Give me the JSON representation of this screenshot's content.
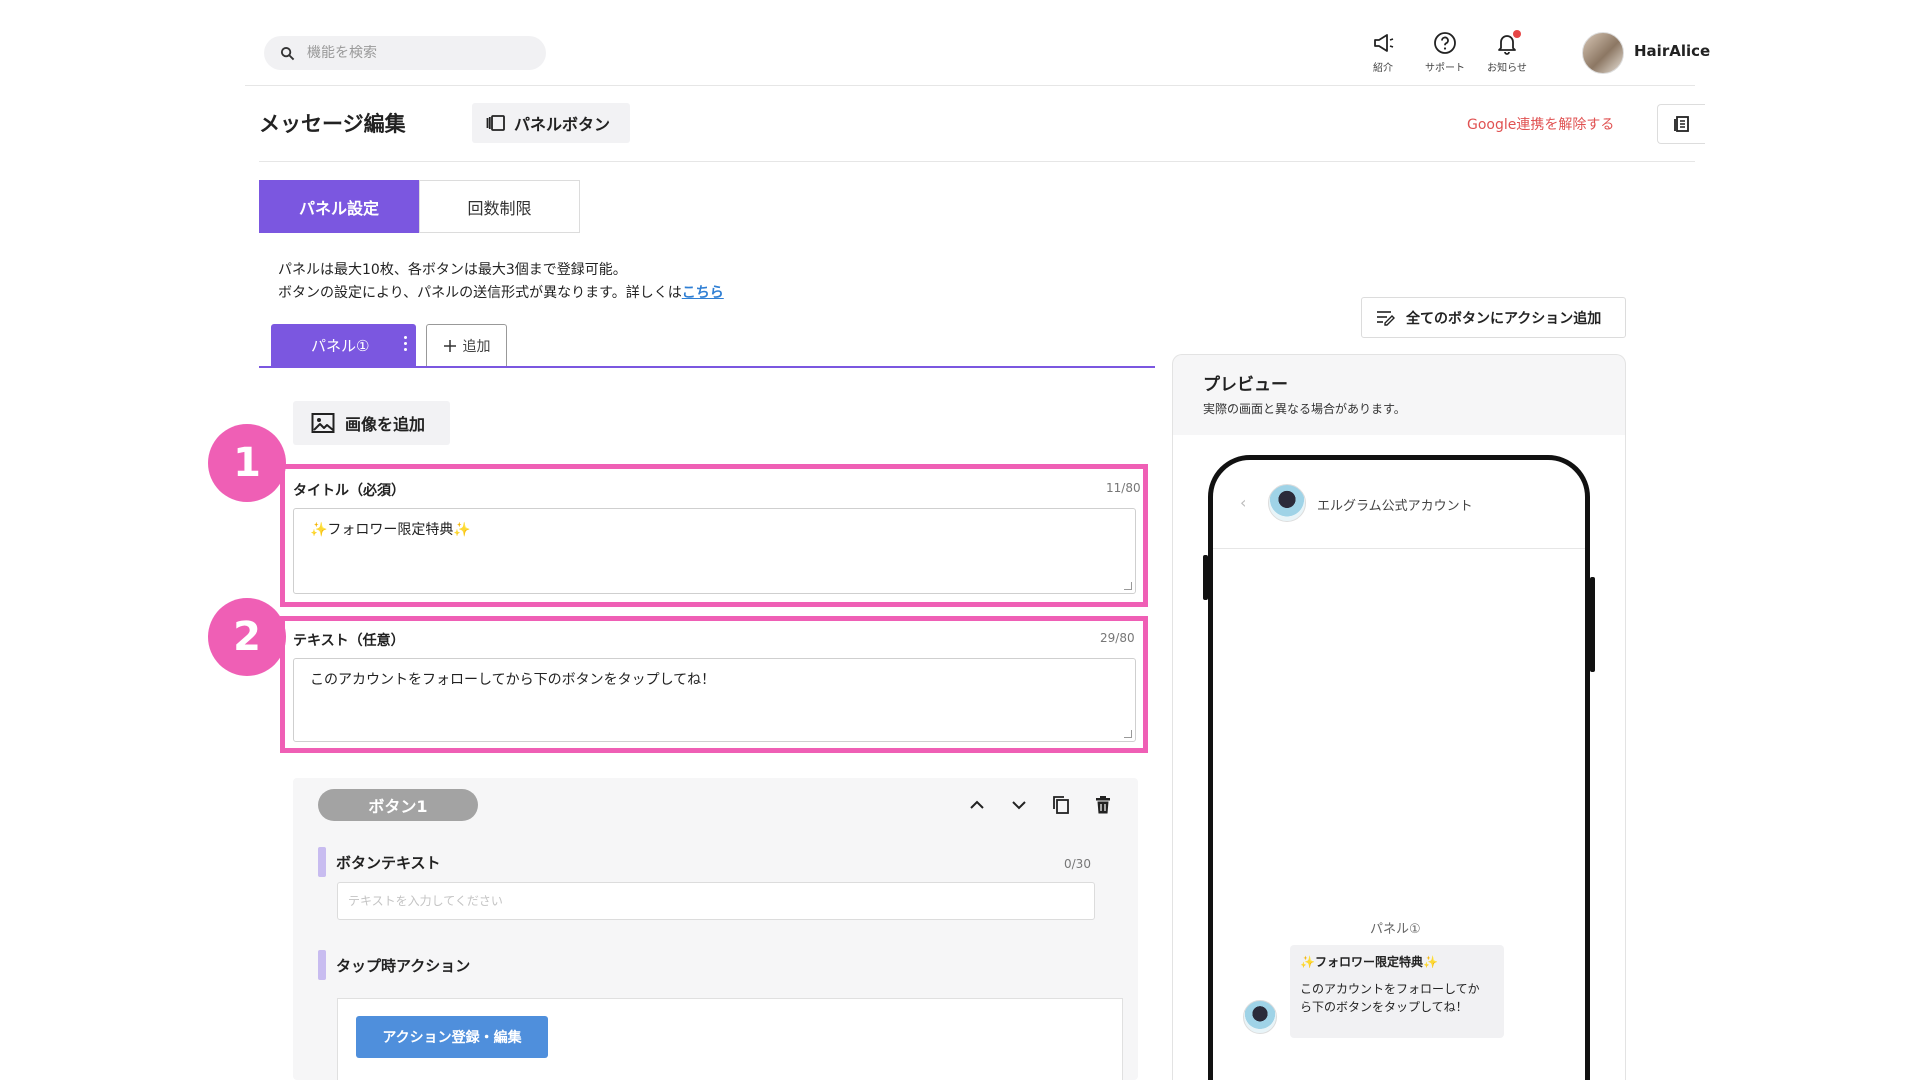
{
  "topbar": {
    "search_placeholder": "機能を検索",
    "icons": [
      {
        "name": "megaphone-icon",
        "label": "紹介"
      },
      {
        "name": "help-icon",
        "label": "サポート"
      },
      {
        "name": "bell-icon",
        "label": "お知らせ"
      }
    ],
    "user_name": "HairAlice"
  },
  "header": {
    "title": "メッセージ編集",
    "panel_button_label": "パネルボタン",
    "google_unlink": "Google連携を解除する"
  },
  "tabs": [
    {
      "label": "パネル設定",
      "active": true
    },
    {
      "label": "回数制限",
      "active": false
    }
  ],
  "description": {
    "line1": "パネルは最大10枚、各ボタンは最大3個まで登録可能。",
    "line2": "ボタンの設定により、パネルの送信形式が異なります。詳しくは",
    "link": "こちら"
  },
  "panel_tabs": {
    "current": "パネル①",
    "add": "追加"
  },
  "add_image_label": "画像を追加",
  "fields": {
    "title": {
      "badge": "1",
      "label": "タイトル（必須）",
      "counter": "11/80",
      "value": "✨フォロワー限定特典✨"
    },
    "text": {
      "badge": "2",
      "label": "テキスト（任意）",
      "counter": "29/80",
      "value": "このアカウントをフォローしてから下のボタンをタップしてね！"
    }
  },
  "button_section": {
    "pill": "ボタン1",
    "button_text_label": "ボタンテキスト",
    "button_text_counter": "0/30",
    "button_text_placeholder": "テキストを入力してください",
    "tap_action_label": "タップ時アクション",
    "action_button": "アクション登録・編集"
  },
  "right": {
    "all_action_button": "全てのボタンにアクション追加",
    "preview_title": "プレビュー",
    "preview_note": "実際の画面と異なる場合があります。",
    "account_name": "エルグラム公式アカウント",
    "panel_label": "パネル①",
    "bubble_title": "フォロワー限定特典",
    "bubble_text_line1": "このアカウントをフォローしてか",
    "bubble_text_line2": "ら下のボタンをタップしてね！"
  },
  "colors": {
    "accent": "#7b57e0",
    "highlight": "#ef5fb5",
    "link": "#2f7fd4",
    "danger": "#e05252",
    "action": "#4f8fdc"
  }
}
